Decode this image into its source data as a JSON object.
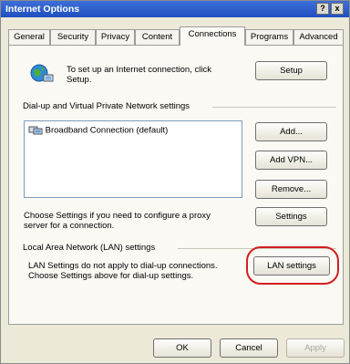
{
  "window": {
    "title": "Internet Options",
    "help_label": "?",
    "close_label": "x"
  },
  "tabs": [
    {
      "label": "General"
    },
    {
      "label": "Security"
    },
    {
      "label": "Privacy"
    },
    {
      "label": "Content"
    },
    {
      "label": "Connections",
      "active": true
    },
    {
      "label": "Programs"
    },
    {
      "label": "Advanced"
    }
  ],
  "setup": {
    "icon": "globe-connection-icon",
    "line1": "To set up an Internet connection, click",
    "line2": "Setup.",
    "button": "Setup"
  },
  "dialup": {
    "header": "Dial-up and Virtual Private Network settings",
    "connections": [
      {
        "label": "Broadband Connection (default)",
        "icon": "network-connection-icon"
      }
    ],
    "add_button": "Add...",
    "add_vpn_button": "Add VPN...",
    "remove_button": "Remove...",
    "proxy_line1": "Choose Settings if you need to configure a proxy",
    "proxy_line2": "server for a connection.",
    "settings_button": "Settings"
  },
  "lan": {
    "header": "Local Area Network (LAN) settings",
    "line1": "LAN Settings do not apply to dial-up connections.",
    "line2": "Choose Settings above for dial-up settings.",
    "button": "LAN settings",
    "highlight_color": "#d21f1f"
  },
  "footer": {
    "ok": "OK",
    "cancel": "Cancel",
    "apply": "Apply"
  }
}
